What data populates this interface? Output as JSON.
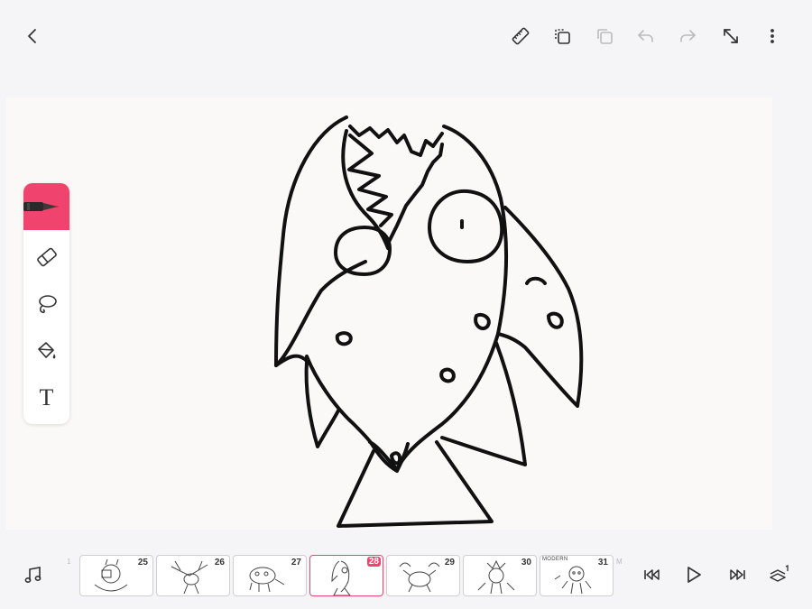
{
  "toolbar": {
    "icons": [
      "back-icon",
      "ruler-icon",
      "duplicate-icon",
      "layers-icon",
      "undo-icon",
      "redo-icon",
      "fullscreen-icon",
      "more-icon"
    ]
  },
  "tools": [
    "pen-tool",
    "eraser-tool",
    "lasso-tool",
    "fill-tool",
    "text-tool"
  ],
  "tools_text_glyph": "T",
  "accent_color": "#f0436e",
  "timeline": {
    "left_mark": "1",
    "right_mark": "M",
    "frames": [
      {
        "number": "25",
        "active": false
      },
      {
        "number": "26",
        "active": false
      },
      {
        "number": "27",
        "active": false
      },
      {
        "number": "28",
        "active": true
      },
      {
        "number": "29",
        "active": false
      },
      {
        "number": "30",
        "active": false
      },
      {
        "number": "31",
        "active": false,
        "label": "MODERN"
      }
    ]
  },
  "playback": {
    "icons": [
      "music-icon",
      "skip-back-icon",
      "play-icon",
      "skip-forward-icon",
      "onion-layers-icon"
    ]
  }
}
